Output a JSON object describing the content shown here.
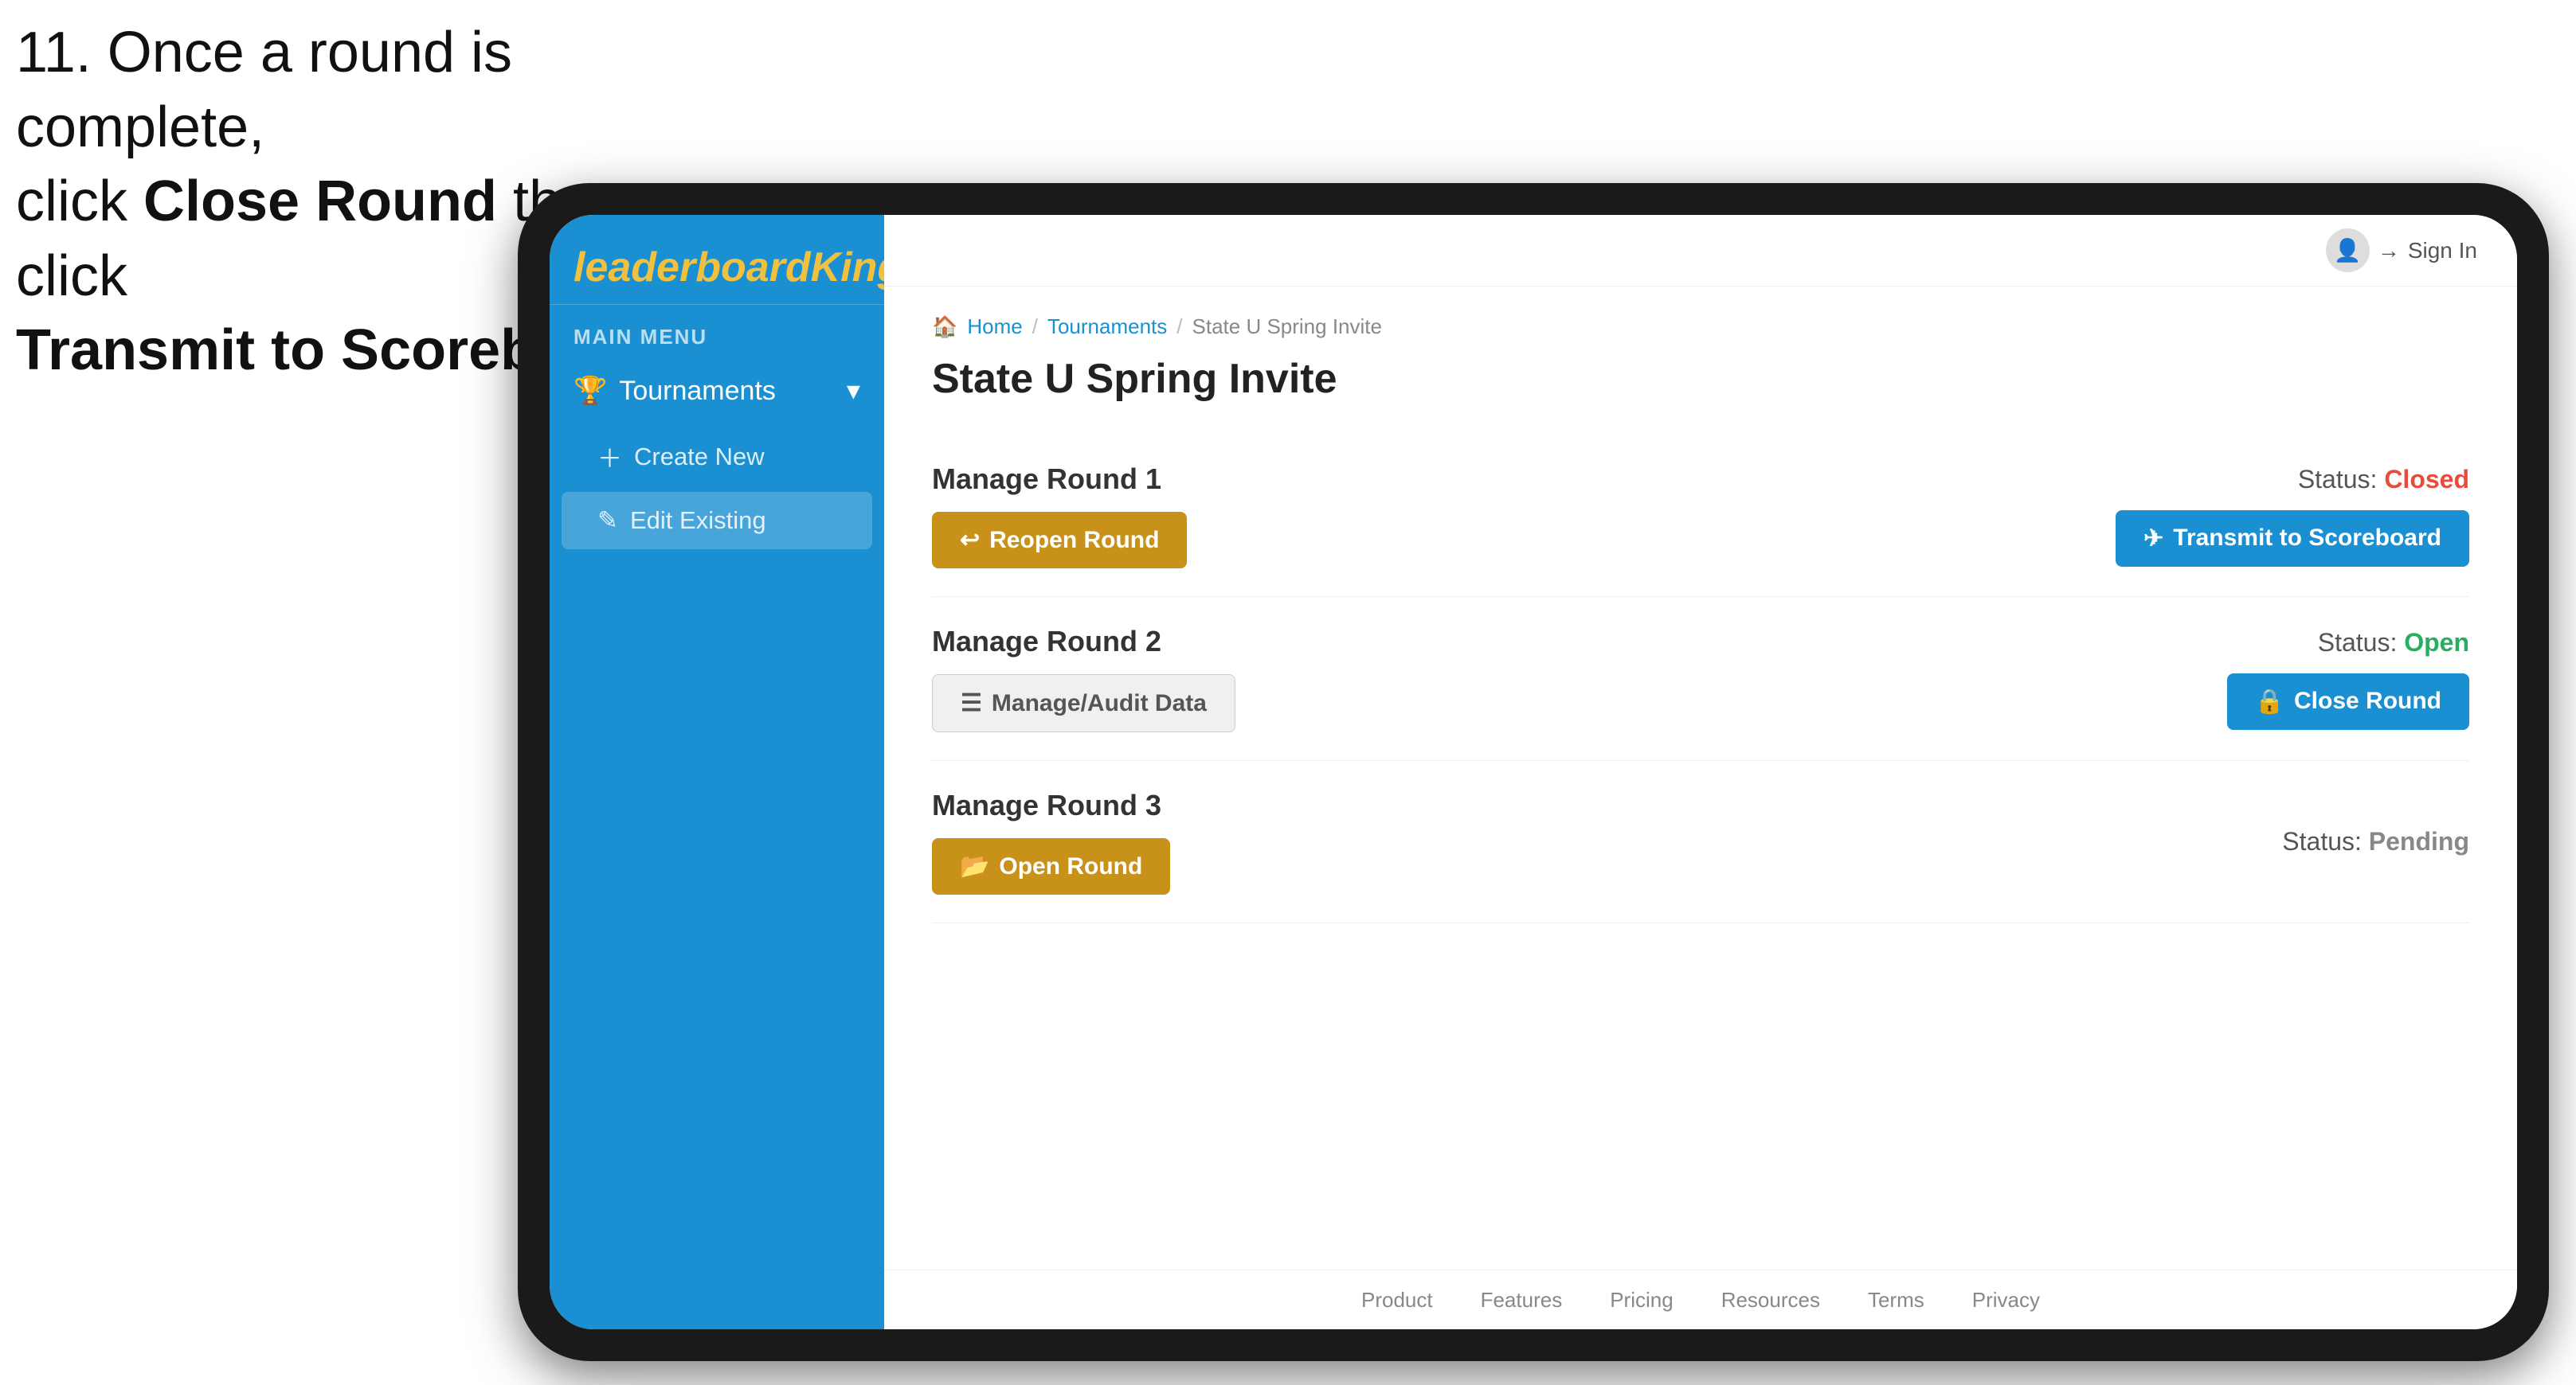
{
  "instruction": {
    "line1": "11. Once a round is complete,",
    "line2": "click ",
    "bold1": "Close Round",
    "line3": " then click",
    "bold2": "Transmit to Scoreboard."
  },
  "sidebar": {
    "logo_plain": "leaderboard",
    "logo_bold": "King",
    "main_menu_label": "MAIN MENU",
    "nav_items": [
      {
        "label": "Tournaments",
        "icon": "trophy-icon",
        "expanded": true
      }
    ],
    "sub_items": [
      {
        "label": "Create New",
        "icon": "plus-icon",
        "active": false
      },
      {
        "label": "Edit Existing",
        "icon": "edit-icon",
        "active": true
      }
    ]
  },
  "header": {
    "sign_in_label": "Sign In"
  },
  "breadcrumb": {
    "home": "Home",
    "tournaments": "Tournaments",
    "current": "State U Spring Invite"
  },
  "page": {
    "title": "State U Spring Invite",
    "rounds": [
      {
        "id": "round1",
        "title": "Manage Round 1",
        "status_label": "Status:",
        "status_value": "Closed",
        "status_type": "closed",
        "buttons": [
          {
            "label": "Reopen Round",
            "type": "amber",
            "icon": "reopen-icon"
          },
          {
            "label": "Transmit to Scoreboard",
            "type": "blue",
            "icon": "transmit-icon"
          }
        ]
      },
      {
        "id": "round2",
        "title": "Manage Round 2",
        "status_label": "Status:",
        "status_value": "Open",
        "status_type": "open",
        "buttons": [
          {
            "label": "Manage/Audit Data",
            "type": "outline",
            "icon": "audit-icon"
          },
          {
            "label": "Close Round",
            "type": "blue",
            "icon": "close-icon"
          }
        ]
      },
      {
        "id": "round3",
        "title": "Manage Round 3",
        "status_label": "Status:",
        "status_value": "Pending",
        "status_type": "pending",
        "buttons": [
          {
            "label": "Open Round",
            "type": "amber",
            "icon": "open-icon"
          }
        ]
      }
    ]
  },
  "footer": {
    "links": [
      "Product",
      "Features",
      "Pricing",
      "Resources",
      "Terms",
      "Privacy"
    ]
  }
}
